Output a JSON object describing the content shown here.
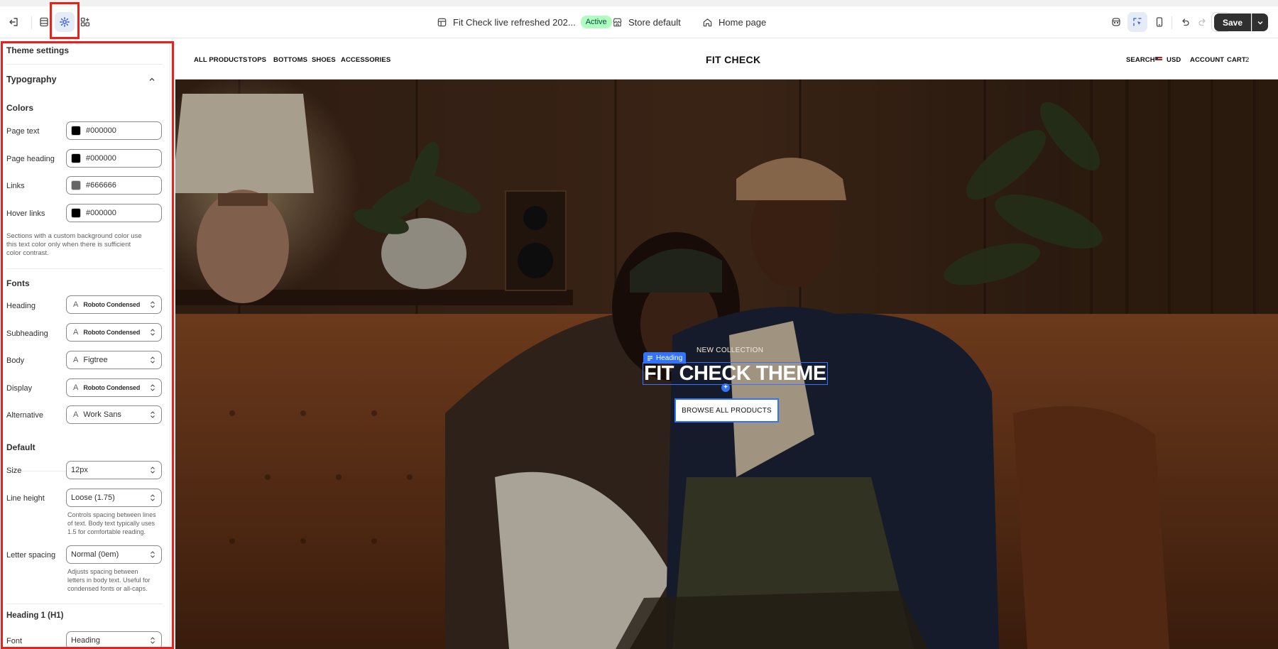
{
  "topbar": {
    "theme_name": "Fit Check live refreshed 202...",
    "status": "Active",
    "store": "Store default",
    "page": "Home page",
    "save_label": "Save"
  },
  "sidebar": {
    "title": "Theme settings",
    "group": "Typography",
    "colors_title": "Colors",
    "colors": [
      {
        "label": "Page text",
        "value": "#000000",
        "swatch": "#000000"
      },
      {
        "label": "Page heading",
        "value": "#000000",
        "swatch": "#000000"
      },
      {
        "label": "Links",
        "value": "#666666",
        "swatch": "#666666"
      },
      {
        "label": "Hover links",
        "value": "#000000",
        "swatch": "#000000"
      }
    ],
    "colors_help_1": "Sections with a custom background color use",
    "colors_help_2": "this text color only when there is sufficient",
    "colors_help_3": "color contrast.",
    "fonts_title": "Fonts",
    "fonts": [
      {
        "label": "Heading",
        "value": "Roboto Condensed"
      },
      {
        "label": "Subheading",
        "value": "Roboto Condensed"
      },
      {
        "label": "Body",
        "value": "Figtree"
      },
      {
        "label": "Display",
        "value": "Roboto Condensed"
      },
      {
        "label": "Alternative",
        "value": "Work Sans"
      }
    ],
    "default_title": "Default",
    "size_label": "Size",
    "size_value": "12px",
    "line_height_label": "Line height",
    "line_height_value": "Loose (1.75)",
    "line_height_help_1": "Controls spacing between lines",
    "line_height_help_2": "of text. Body text typically uses",
    "line_height_help_3": "1.5 for comfortable reading.",
    "letter_spacing_label": "Letter spacing",
    "letter_spacing_value": "Normal (0em)",
    "letter_spacing_help_1": "Adjusts spacing between",
    "letter_spacing_help_2": "letters in body text. Useful for",
    "letter_spacing_help_3": "condensed fonts or all-caps.",
    "h1_title": "Heading 1 (H1)",
    "h1_font_label": "Font",
    "h1_font_value": "Heading"
  },
  "store": {
    "nav": [
      "ALL PRODUCTS",
      "TOPS",
      "BOTTOMS",
      "SHOES",
      "ACCESSORIES"
    ],
    "logo": "FIT CHECK",
    "search": "SEARCH",
    "currency": "USD",
    "account": "ACCOUNT",
    "cart": "CART",
    "cart_count": "2"
  },
  "hero": {
    "subheading": "NEW COLLECTION",
    "heading": "FIT CHECK THEME",
    "heading_tag": "Heading",
    "button": "BROWSE ALL PRODUCTS"
  }
}
